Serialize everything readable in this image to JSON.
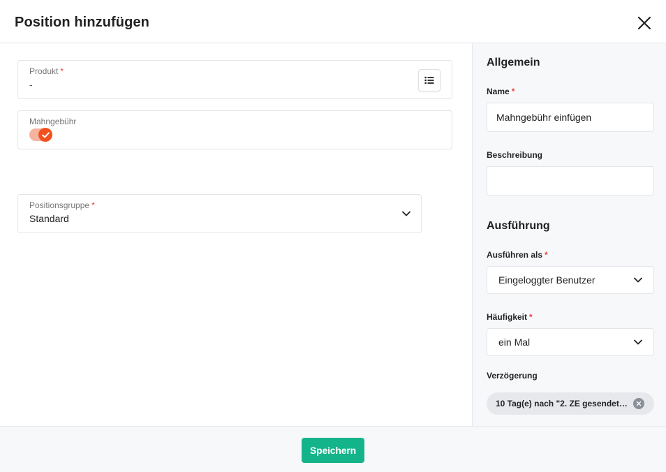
{
  "dialog": {
    "title": "Position hinzufügen"
  },
  "main": {
    "produkt": {
      "label": "Produkt",
      "required": "*",
      "value": "-"
    },
    "mahngebuehr": {
      "label": "Mahngebühr",
      "enabled": true
    },
    "positionsgruppe": {
      "label": "Positionsgruppe",
      "required": "*",
      "value": "Standard"
    }
  },
  "sidebar": {
    "allgemein_heading": "Allgemein",
    "name": {
      "label": "Name",
      "required": "*",
      "value": "Mahngebühr einfügen"
    },
    "beschreibung": {
      "label": "Beschreibung",
      "value": ""
    },
    "ausfuehrung_heading": "Ausführung",
    "ausfuehren_als": {
      "label": "Ausführen als",
      "required": "*",
      "value": "Eingeloggter Benutzer"
    },
    "haeufigkeit": {
      "label": "Häufigkeit",
      "required": "*",
      "value": "ein Mal"
    },
    "verzoegerung": {
      "label": "Verzögerung",
      "chip": "10 Tag(e) nach \"2. ZE gesendet a..."
    }
  },
  "footer": {
    "save_label": "Speichern"
  },
  "colors": {
    "accent": "#14b48a",
    "toggle_on": "#f0521f",
    "required": "#e8453c"
  },
  "icons": [
    "close-icon",
    "list-icon",
    "check-icon",
    "chevron-down-icon",
    "x-icon"
  ]
}
